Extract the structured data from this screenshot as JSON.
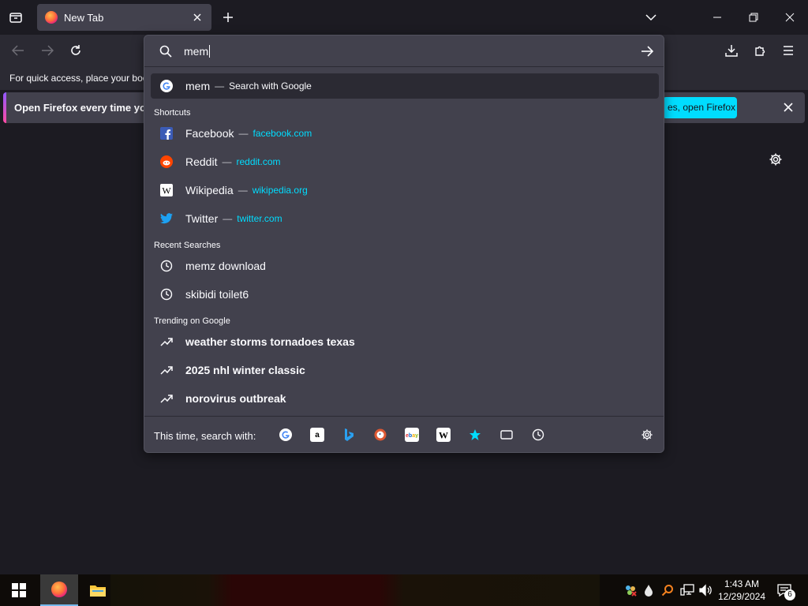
{
  "tab": {
    "title": "New Tab"
  },
  "bookmarks_bar": {
    "text": "For quick access, place your boo"
  },
  "notification": {
    "message": "Open Firefox every time you",
    "button_label": "es, open Firefox"
  },
  "urlbar": {
    "value": "mem",
    "heuristic": {
      "label": "mem",
      "separator": "—",
      "action": "Search with Google"
    },
    "shortcuts_label": "Shortcuts",
    "shortcuts": [
      {
        "label": "Facebook",
        "separator": "—",
        "url": "facebook.com",
        "icon": "facebook-icon"
      },
      {
        "label": "Reddit",
        "separator": "—",
        "url": "reddit.com",
        "icon": "reddit-icon"
      },
      {
        "label": "Wikipedia",
        "separator": "—",
        "url": "wikipedia.org",
        "icon": "wikipedia-icon"
      },
      {
        "label": "Twitter",
        "separator": "—",
        "url": "twitter.com",
        "icon": "twitter-icon"
      }
    ],
    "recent_label": "Recent Searches",
    "recent": [
      {
        "label": "memz download",
        "icon": "clock-icon"
      },
      {
        "label": "skibidi toilet6",
        "icon": "clock-icon"
      }
    ],
    "trending_label": "Trending on Google",
    "trending": [
      {
        "label": "weather storms tornadoes texas",
        "icon": "trending-icon"
      },
      {
        "label": "2025 nhl winter classic",
        "icon": "trending-icon"
      },
      {
        "label": "norovirus outbreak",
        "icon": "trending-icon"
      }
    ],
    "footer_label": "This time, search with:",
    "engines": [
      "google-icon",
      "amazon-icon",
      "bing-icon",
      "duckduckgo-icon",
      "ebay-icon",
      "wikipedia-icon",
      "bookmarks-icon",
      "tabs-icon",
      "history-icon"
    ]
  },
  "taskbar": {
    "time": "1:43 AM",
    "date": "12/29/2024",
    "notification_count": "6"
  },
  "colors": {
    "accent": "#00ddff",
    "panel": "#42414d",
    "background": "#1c1b22"
  }
}
